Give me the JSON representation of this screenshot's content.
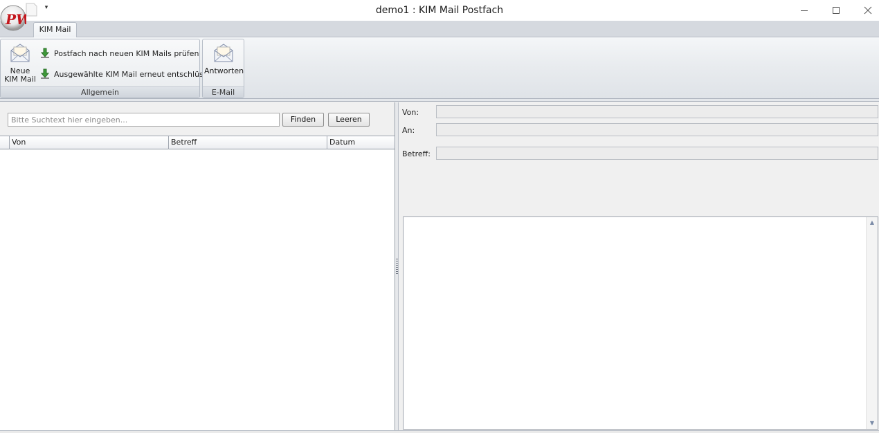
{
  "window": {
    "title": "demo1 : KIM Mail Postfach",
    "logo_text": "PW"
  },
  "ribbon": {
    "tabs": [
      {
        "label": "KIM Mail",
        "active": true
      }
    ],
    "groups": {
      "allgemein": {
        "caption": "Allgemein",
        "new_mail_label": "Neue KIM Mail",
        "check_mailbox_label": "Postfach nach neuen KIM Mails prüfen",
        "decrypt_label": "Ausgewählte KIM Mail erneut entschlüsseln"
      },
      "email": {
        "caption": "E-Mail",
        "reply_label": "Antworten"
      }
    }
  },
  "search": {
    "placeholder": "Bitte Suchtext hier eingeben...",
    "value": "",
    "find_label": "Finden",
    "clear_label": "Leeren"
  },
  "mail_list": {
    "columns": [
      "Von",
      "Betreff",
      "Datum"
    ],
    "rows": []
  },
  "detail": {
    "from_label": "Von:",
    "to_label": "An:",
    "subject_label": "Betreff:",
    "from_value": "",
    "to_value": "",
    "subject_value": "",
    "body": ""
  },
  "colors": {
    "ribbon_bg": "#e9ecef",
    "tab_strip": "#d5d9df",
    "accent_green": "#3f9a3a"
  }
}
